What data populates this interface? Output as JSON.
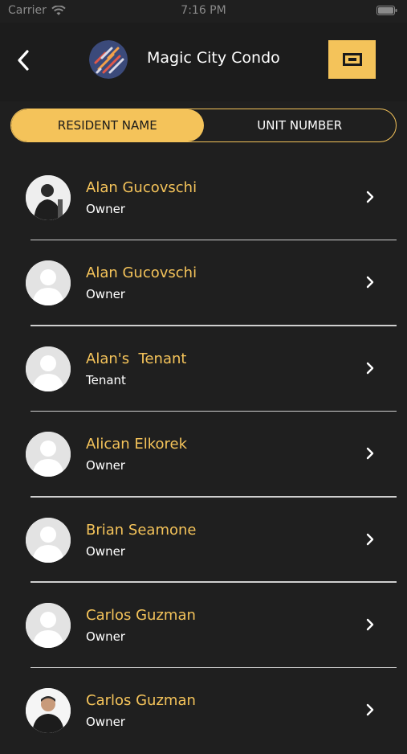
{
  "status_bar": {
    "carrier": "Carrier",
    "time": "7:16 PM"
  },
  "header": {
    "title": "Magic City Condo",
    "back_icon": "chevron-left-icon",
    "action_icon": "rectangle-icon",
    "accent_color": "#f4c35a"
  },
  "tabs": [
    {
      "label": "RESIDENT NAME",
      "active": true
    },
    {
      "label": "UNIT NUMBER",
      "active": false
    }
  ],
  "residents": [
    {
      "name": "Alan Gucovschi",
      "role": "Owner",
      "avatar": "photo"
    },
    {
      "name": "Alan Gucovschi",
      "role": "Owner",
      "avatar": "placeholder"
    },
    {
      "name": "Alan's  Tenant",
      "role": "Tenant",
      "avatar": "placeholder"
    },
    {
      "name": "Alican Elkorek",
      "role": "Owner",
      "avatar": "placeholder"
    },
    {
      "name": "Brian Seamone",
      "role": "Owner",
      "avatar": "placeholder"
    },
    {
      "name": "Carlos Guzman",
      "role": "Owner",
      "avatar": "placeholder"
    },
    {
      "name": "Carlos Guzman",
      "role": "Owner",
      "avatar": "photo"
    }
  ]
}
